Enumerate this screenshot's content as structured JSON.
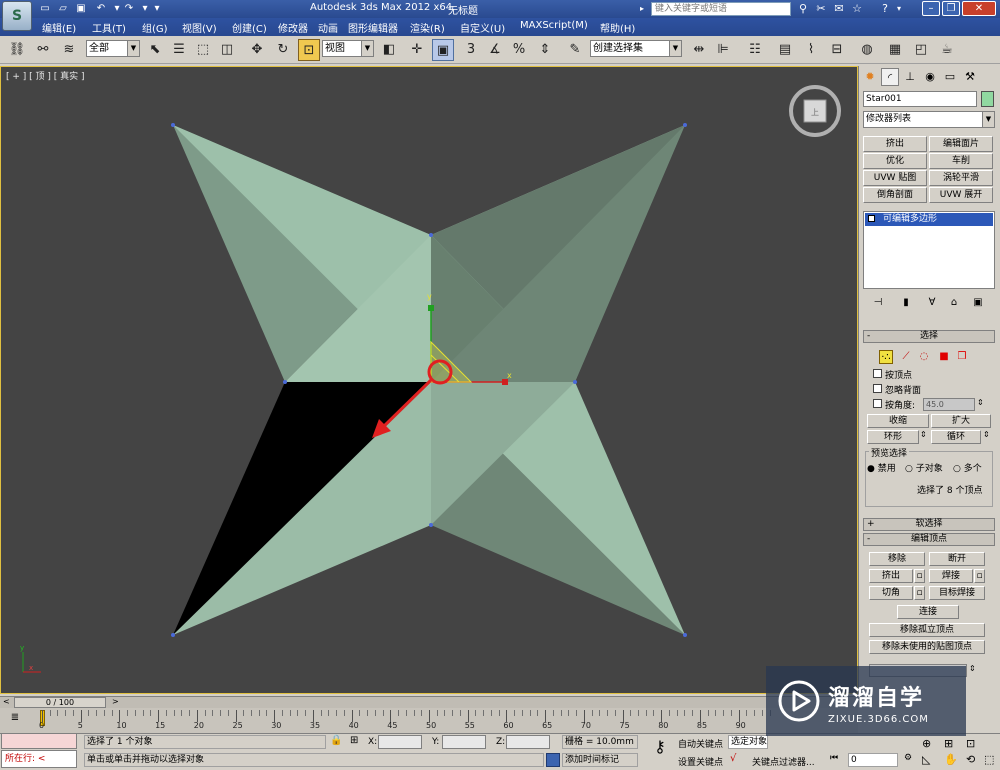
{
  "titlebar": {
    "app_title": "Autodesk 3ds Max  2012 x64",
    "doc_title": "无标题",
    "search_placeholder": "键入关键字或短语",
    "logo_text": "S"
  },
  "menu": [
    "编辑(E)",
    "工具(T)",
    "组(G)",
    "视图(V)",
    "创建(C)",
    "修改器",
    "动画",
    "图形编辑器",
    "渲染(R)",
    "自定义(U)",
    "MAXScript(M)",
    "帮助(H)"
  ],
  "toolbar": {
    "selection_filter": "全部",
    "ref_coord": "视图",
    "named_selection": "创建选择集",
    "snap_3": "3",
    "snap_percent": "%"
  },
  "viewport": {
    "label": "[ + ] [ 顶 ] [ 真实 ]",
    "gizmo_x": "x",
    "gizmo_y": "y"
  },
  "panel": {
    "object_name": "Star001",
    "modifier_list": "修改器列表",
    "modifier_buttons": [
      [
        "挤出",
        "编辑面片"
      ],
      [
        "优化",
        "车削"
      ],
      [
        "UVW 贴图",
        "涡轮平滑"
      ],
      [
        "倒角剖面",
        "UVW 展开"
      ]
    ],
    "stack_item": "可编辑多边形",
    "selection_rollout": "选择",
    "by_vertex": "按顶点",
    "ignore_backface": "忽略背面",
    "by_angle": "按角度:",
    "angle_value": "45.0",
    "shrink": "收缩",
    "grow": "扩大",
    "ring": "环形",
    "loop": "循环",
    "preview_label": "预览选择",
    "preview_off": "禁用",
    "preview_sub": "子对象",
    "preview_multi": "多个",
    "selection_info": "选择了 8 个顶点",
    "soft_selection": "软选择",
    "edit_vertices": "编辑顶点",
    "remove": "移除",
    "break": "断开",
    "extrude": "挤出",
    "weld": "焊接",
    "chamfer": "切角",
    "target_weld": "目标焊接",
    "connect": "连接",
    "remove_isolated": "移除孤立顶点",
    "remove_unused_map": "移除未使用的贴图顶点"
  },
  "timeline": {
    "frame": "0 / 100",
    "ticks": [
      "0",
      "5",
      "10",
      "15",
      "20",
      "25",
      "30",
      "35",
      "40",
      "45",
      "50",
      "55",
      "60",
      "65",
      "70",
      "75",
      "80",
      "85",
      "90"
    ]
  },
  "status": {
    "maxscript": "所在行:",
    "selected": "选择了 1 个对象",
    "prompt": "单击或单击并拖动以选择对象",
    "x_label": "X:",
    "y_label": "Y:",
    "z_label": "Z:",
    "grid": "栅格 = 10.0mm",
    "add_time_tag": "添加时间标记",
    "auto_key": "自动关键点",
    "set_key": "设置关键点",
    "selected_obj": "选定对象",
    "key_filters": "关键点过滤器...",
    "frame_value": "0"
  },
  "watermark": {
    "title": "溜溜自学",
    "sub": "ZIXUE.3D66.COM"
  },
  "colors": {
    "viewport_bg": "#444444",
    "face_light": "#a7c8b2",
    "face_mid": "#8bab98",
    "face_dark": "#5f7566",
    "selected_face": "#000000",
    "arrow": "#e02020"
  }
}
